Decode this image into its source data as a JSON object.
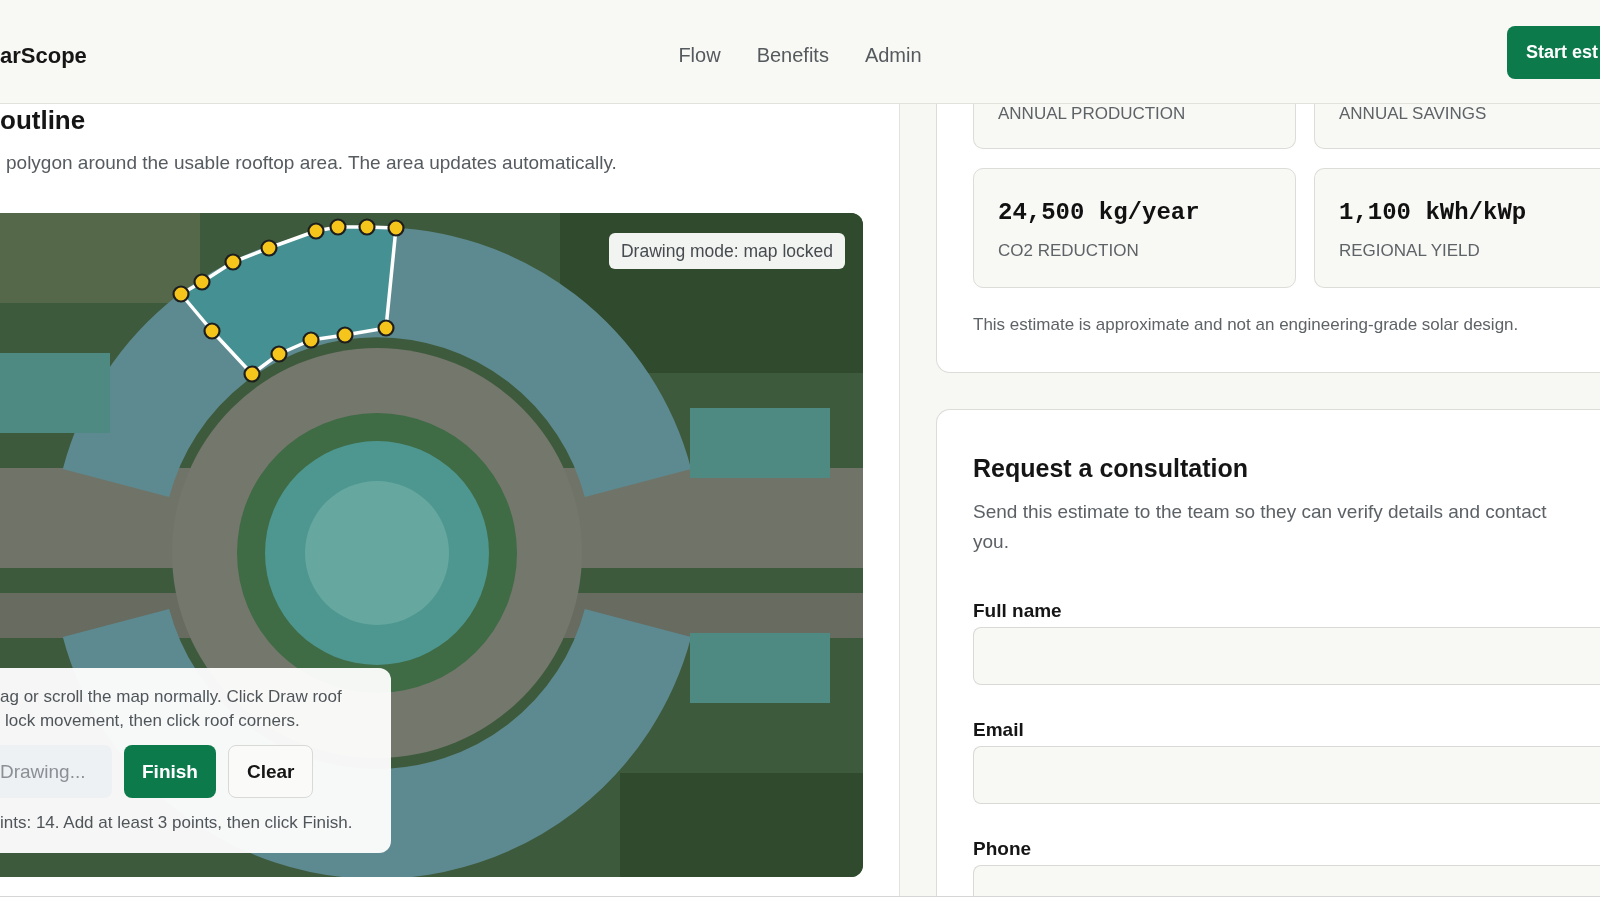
{
  "header": {
    "logo": "arScope",
    "nav": [
      {
        "label": "Flow"
      },
      {
        "label": "Benefits"
      },
      {
        "label": "Admin"
      }
    ],
    "cta": "Start est"
  },
  "roof_panel": {
    "title": "outline",
    "description": "polygon around the usable rooftop area. The area updates automatically.",
    "map": {
      "mode_badge": "Drawing mode: map locked",
      "hint_lines": [
        "ag or scroll the map normally. Click Draw roof",
        "lock movement, then click roof corners."
      ],
      "buttons": [
        {
          "label": "Drawing...",
          "kind": "toggle",
          "disabled": true
        },
        {
          "label": "Finish",
          "kind": "primary",
          "disabled": false
        },
        {
          "label": "Clear",
          "kind": "secondary",
          "disabled": false
        }
      ],
      "status": "ints: 14. Add at least 3 points, then click Finish."
    }
  },
  "results": {
    "stats": [
      {
        "label": "ANNUAL PRODUCTION"
      },
      {
        "label": "ANNUAL SAVINGS"
      },
      {
        "value": "24,500 kg/year",
        "label": "CO2 REDUCTION"
      },
      {
        "value": "1,100 kWh/kWp",
        "label": "REGIONAL YIELD"
      }
    ],
    "note": "This estimate is approximate and not an engineering-grade solar design."
  },
  "consultation": {
    "title": "Request a consultation",
    "description": "Send this estimate to the team so they can verify details and contact you.",
    "fields": [
      {
        "label": "Full name"
      },
      {
        "label": "Email"
      },
      {
        "label": "Phone"
      }
    ]
  }
}
